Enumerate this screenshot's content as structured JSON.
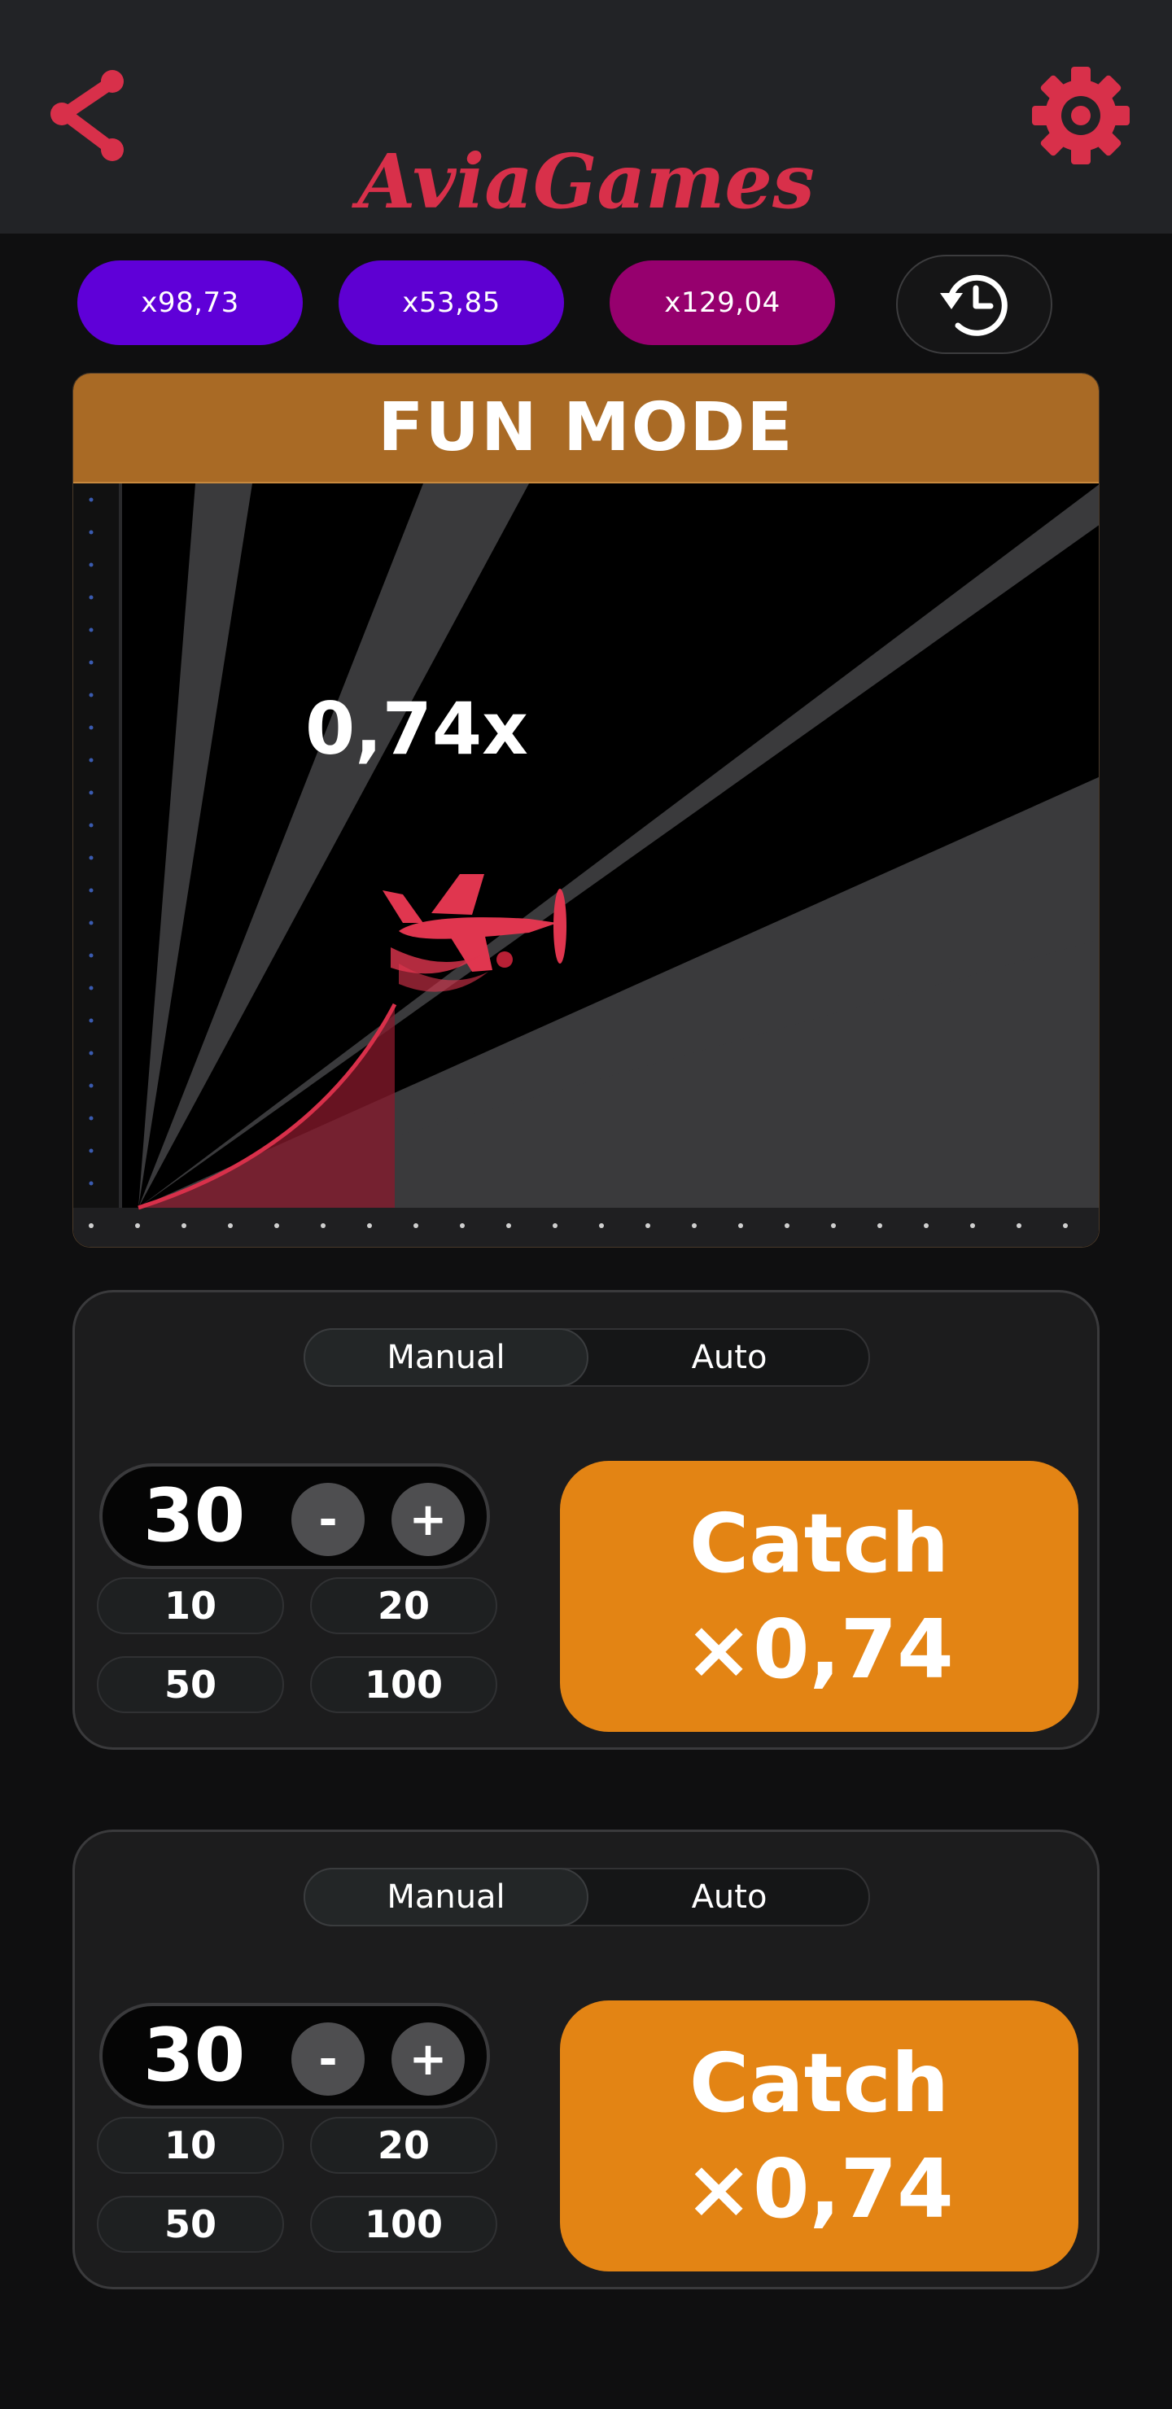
{
  "app": {
    "logo_text": "AviaGames"
  },
  "history": [
    "x98,73",
    "x53,85",
    "x129,04"
  ],
  "game": {
    "mode_label": "FUN MODE",
    "multiplier": "0,74x"
  },
  "bet_panels": [
    {
      "mode_options": [
        "Manual",
        "Auto"
      ],
      "active_mode": "Manual",
      "amount": "30",
      "minus_label": "-",
      "plus_label": "+",
      "quick_amounts": [
        "10",
        "20",
        "50",
        "100"
      ],
      "catch_label": "Catch",
      "catch_multiplier": "×0,74"
    },
    {
      "mode_options": [
        "Manual",
        "Auto"
      ],
      "active_mode": "Manual",
      "amount": "30",
      "minus_label": "-",
      "plus_label": "+",
      "quick_amounts": [
        "10",
        "20",
        "50",
        "100"
      ],
      "catch_label": "Catch",
      "catch_multiplier": "×0,74"
    }
  ],
  "colors": {
    "accent": "#d8304a",
    "header_bg": "#222326",
    "banner": "#a96a25",
    "catch": "#e38414",
    "history_purple": "#5f00d8",
    "history_magenta": "#96006e"
  },
  "icons": [
    "share-icon",
    "gear-icon",
    "history-icon",
    "airplane-icon"
  ]
}
